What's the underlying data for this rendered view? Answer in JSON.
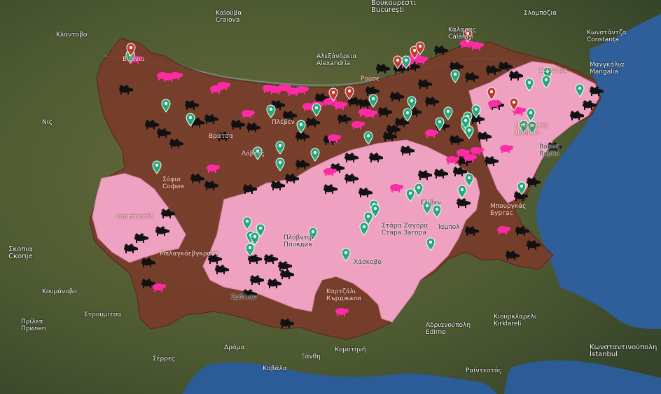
{
  "map": {
    "cities": [
      {
        "name": "Καϊούβα",
        "sub": "Craiova"
      },
      {
        "name": "Βουκουρέστι",
        "sub": "București"
      },
      {
        "name": "Κωνστάντζα",
        "sub": "Constanța"
      },
      {
        "name": "Μανγκάλια",
        "sub": "Mangalia"
      },
      {
        "name": "Σόφια",
        "sub": "София"
      },
      {
        "name": "Σκόπια",
        "sub": "Скопје"
      },
      {
        "name": "Αλεξάνδρεια",
        "sub": "Alexandria"
      },
      {
        "name": "Ντόμπριτς",
        "sub": "Добрич"
      },
      {
        "name": "Στάρα Ζαγόρα",
        "sub": "Стара Загора"
      },
      {
        "name": "Μπουργκάς",
        "sub": "Бургас"
      },
      {
        "name": "Κωνσταντινούπολη",
        "sub": "İstanbul"
      },
      {
        "name": "Αδριανούπολη",
        "sub": "Edirne"
      },
      {
        "name": "Κομοτηνή",
        "sub": ""
      },
      {
        "name": "Καβάλα",
        "sub": ""
      },
      {
        "name": "Ξάνθη",
        "sub": ""
      },
      {
        "name": "Δράμα",
        "sub": ""
      },
      {
        "name": "Σέρρες",
        "sub": ""
      },
      {
        "name": "Πρίλεπ",
        "sub": "Прилеп"
      },
      {
        "name": "Κιουστεντίλ",
        "sub": ""
      },
      {
        "name": "Μπλαγκόεβγκραντ",
        "sub": ""
      },
      {
        "name": "Καρτζάλι",
        "sub": "Кърджали"
      },
      {
        "name": "Σμόλιαν",
        "sub": ""
      },
      {
        "name": "Βάρνα",
        "sub": "Варна"
      },
      {
        "name": "Σιλίστρα",
        "sub": ""
      },
      {
        "name": "Ρούσε",
        "sub": ""
      },
      {
        "name": "Βράτσα",
        "sub": ""
      },
      {
        "name": "Κλάντοβο",
        "sub": ""
      },
      {
        "name": "Βιδίνιο",
        "sub": ""
      },
      {
        "name": "Πλόβντιβ",
        "sub": "Пловдив"
      },
      {
        "name": "Χάσκοβο",
        "sub": ""
      },
      {
        "name": "Λόβετς",
        "sub": ""
      },
      {
        "name": "Πλέβεν",
        "sub": ""
      },
      {
        "name": "Ίαμπολ",
        "sub": ""
      },
      {
        "name": "Σλίβεν",
        "sub": ""
      },
      {
        "name": "Κιουρκλαρέλι",
        "sub": "Kırklareli"
      },
      {
        "name": "Ραίντεστός",
        "sub": ""
      },
      {
        "name": "Κουμάνοβο",
        "sub": ""
      },
      {
        "name": "Στρουμίτσα",
        "sub": ""
      },
      {
        "name": "Κάλαρας",
        "sub": "Călărași"
      },
      {
        "name": "Σλομπόζια",
        "sub": ""
      },
      {
        "name": "Νις",
        "sub": ""
      }
    ],
    "colors": {
      "land": "#4a5a33",
      "sea": "#2f5f9a",
      "infected_zone": "#7a3a2a",
      "protected_zone": "#f4a6c8",
      "pink_marker": "#ff2aa6",
      "green_pin": "#23a877",
      "red_pin": "#c0392b",
      "boar": "#111111"
    },
    "legend_icons": [
      "boar-silhouette-icon",
      "pig-icon",
      "map-pin-green-icon",
      "map-pin-red-icon"
    ]
  }
}
